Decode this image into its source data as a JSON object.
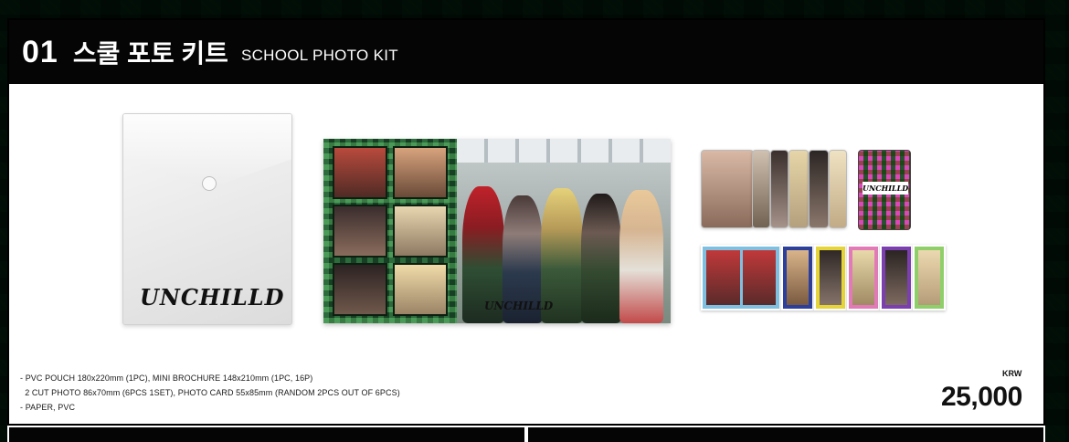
{
  "header": {
    "number": "01",
    "title_korean": "스쿨 포토 키트",
    "title_english": "SCHOOL PHOTO KIT"
  },
  "product": {
    "pouch_logo": "UNCHILLD",
    "brochure_logo": "UNCHILLD",
    "photocard_back_logo": "UNCHILLD",
    "details": [
      "- PVC POUCH 180x220mm (1PC), MINI BROCHURE 148x210mm (1PC, 16P)",
      "  2 CUT PHOTO 86x70mm (6PCS 1SET), PHOTO CARD 55x85mm (RANDOM 2PCS OUT OF 6PCS)",
      "- PAPER, PVC"
    ],
    "currency": "KRW",
    "price": "25,000"
  },
  "colors": {
    "background_plaid": "#0f3a27",
    "header_bg": "#050505",
    "panel_bg": "#ffffff"
  }
}
